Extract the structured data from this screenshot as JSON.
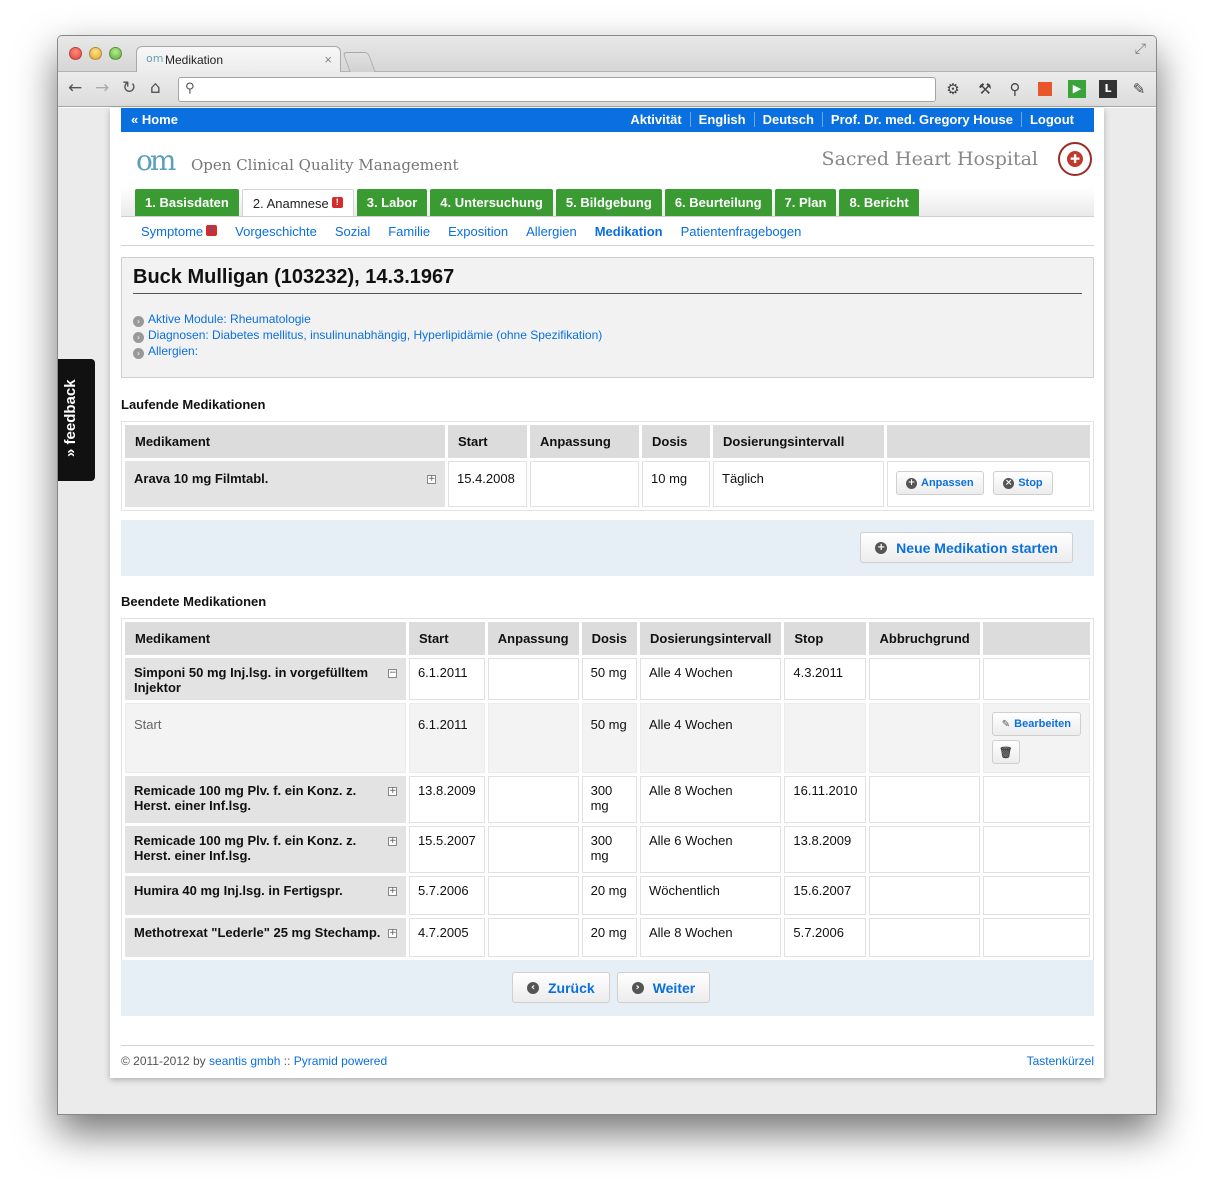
{
  "browser": {
    "tab_title": "Medikation",
    "tab_favicon": "om"
  },
  "topbar": {
    "home": "« Home",
    "links": [
      "Aktivität",
      "English",
      "Deutsch",
      "Prof. Dr. med. Gregory House",
      "Logout"
    ]
  },
  "brand": {
    "logo": "om",
    "subtitle": "Open Clinical Quality Management",
    "hospital": "Sacred Heart Hospital"
  },
  "main_tabs": [
    {
      "label": "1. Basisdaten",
      "active": false,
      "badge": false
    },
    {
      "label": "2. Anamnese",
      "active": true,
      "badge": true
    },
    {
      "label": "3. Labor",
      "active": false,
      "badge": false
    },
    {
      "label": "4. Untersuchung",
      "active": false,
      "badge": false
    },
    {
      "label": "5. Bildgebung",
      "active": false,
      "badge": false
    },
    {
      "label": "6. Beurteilung",
      "active": false,
      "badge": false
    },
    {
      "label": "7. Plan",
      "active": false,
      "badge": false
    },
    {
      "label": "8. Bericht",
      "active": false,
      "badge": false
    }
  ],
  "sub_tabs": [
    {
      "label": "Symptome",
      "badge": true
    },
    {
      "label": "Vorgeschichte"
    },
    {
      "label": "Sozial"
    },
    {
      "label": "Familie"
    },
    {
      "label": "Exposition"
    },
    {
      "label": "Allergien"
    },
    {
      "label": "Medikation",
      "active": true
    },
    {
      "label": "Patientenfragebogen"
    }
  ],
  "patient": {
    "name": "Buck Mulligan (103232), 14.3.1967",
    "links": [
      "Aktive Module: Rheumatologie",
      "Diagnosen: Diabetes mellitus, insulinunabhängig, Hyperlipidämie (ohne Spezifikation)",
      "Allergien:"
    ]
  },
  "running": {
    "heading": "Laufende Medikationen",
    "columns": [
      "Medikament",
      "Start",
      "Anpassung",
      "Dosis",
      "Dosierungsintervall",
      ""
    ],
    "rows": [
      {
        "med": "Arava 10 mg Filmtabl.",
        "start": "15.4.2008",
        "anpassung": "",
        "dosis": "10 mg",
        "intervall": "Täglich",
        "toggle": "+"
      }
    ],
    "btn_adjust": "Anpassen",
    "btn_stop": "Stop",
    "btn_new": "Neue Medikation starten"
  },
  "ended": {
    "heading": "Beendete Medikationen",
    "columns": [
      "Medikament",
      "Start",
      "Anpassung",
      "Dosis",
      "Dosierungsintervall",
      "Stop",
      "Abbruchgrund",
      ""
    ],
    "rows": [
      {
        "med": "Simponi 50 mg Inj.lsg. in vorgefülltem Injektor",
        "start": "6.1.2011",
        "anpassung": "",
        "dosis": "50 mg",
        "intervall": "Alle 4 Wochen",
        "stop": "4.3.2011",
        "grund": "",
        "toggle": "−"
      },
      {
        "med": "Remicade 100 mg Plv. f. ein Konz. z. Herst. einer Inf.lsg.",
        "start": "13.8.2009",
        "anpassung": "",
        "dosis": "300 mg",
        "intervall": "Alle 8 Wochen",
        "stop": "16.11.2010",
        "grund": "",
        "toggle": "+"
      },
      {
        "med": "Remicade 100 mg Plv. f. ein Konz. z. Herst. einer Inf.lsg.",
        "start": "15.5.2007",
        "anpassung": "",
        "dosis": "300 mg",
        "intervall": "Alle 6 Wochen",
        "stop": "13.8.2009",
        "grund": "",
        "toggle": "+"
      },
      {
        "med": "Humira 40 mg Inj.lsg. in Fertigspr.",
        "start": "5.7.2006",
        "anpassung": "",
        "dosis": "20 mg",
        "intervall": "Wöchentlich",
        "stop": "15.6.2007",
        "grund": "",
        "toggle": "+"
      },
      {
        "med": "Methotrexat \"Lederle\" 25 mg Stechamp.",
        "start": "4.7.2005",
        "anpassung": "",
        "dosis": "20 mg",
        "intervall": "Alle 8 Wochen",
        "stop": "5.7.2006",
        "grund": "",
        "toggle": "+"
      }
    ],
    "detail": {
      "label": "Start",
      "start": "6.1.2011",
      "dosis": "50 mg",
      "intervall": "Alle 4 Wochen",
      "btn_edit": "Bearbeiten"
    }
  },
  "nav": {
    "back": "Zurück",
    "next": "Weiter"
  },
  "footer": {
    "copyright": "© 2011-2012 by",
    "company": "seantis gmbh",
    "sep": "::",
    "powered": "Pyramid powered",
    "shortcuts": "Tastenkürzel"
  },
  "feedback": "» feedback",
  "colors": {
    "link": "#0a6fdf",
    "tab_green": "#3a9b33",
    "badge_red": "#d42b2b"
  }
}
